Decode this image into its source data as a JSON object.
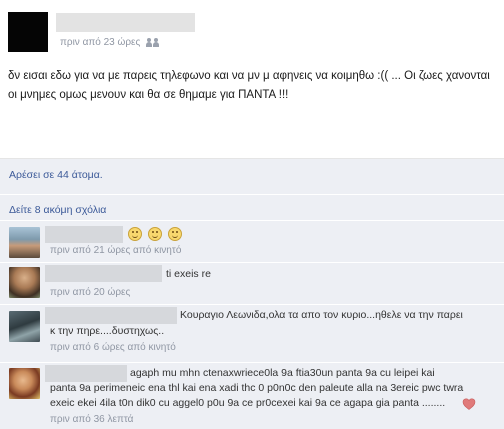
{
  "post": {
    "timestamp": "πριν από 23 ώρες",
    "audience_icon": "people-icon",
    "text": "δν εισαι εδω για να με παρεις τηλεφωνο και να μν μ αφηνεις να κοιμηθω :(( ... Οι ζωες χανονται οι μνημες ομως μενουν και θα σε θημαμε για ΠΑΝΤΑ !!!"
  },
  "likes": {
    "text": "Αρέσει σε 44 άτομα."
  },
  "more_comments": {
    "label": "Δείτε 8 ακόμη σχόλια"
  },
  "comments": [
    {
      "text": "",
      "icons": [
        "smiley-icon",
        "smiley-icon",
        "smiley-icon"
      ],
      "meta": "πριν από 21 ώρες από κινητό"
    },
    {
      "text": "ti exeis re",
      "meta": "πριν από 20 ώρες"
    },
    {
      "text_line1": "Κουραγιο Λεωνιδα,ολα τα απο τον κυριο...ηθελε να την παρει",
      "text_line2": "κ την πηρε....δυστηχως..",
      "meta": "πριν από 6 ώρες από κινητό"
    },
    {
      "text_line1": "agaph mu mhn ctenaxwriece0la 9a ftia30un panta 9a cu leipei kai",
      "text_line2": "panta 9a perimeneic ena thl kai ena xadi thc 0 p0n0c den paleute alla na 3ereic pwc twra",
      "text_line3": "exeic ekei 4ila t0n dik0 cu aggel0 p0u 9a ce pr0cexei kai 9a ce agapa gia panta ........",
      "heart_icon": "heart-icon",
      "meta": "πριν από 36 λεπτά"
    }
  ],
  "colors": {
    "link": "#3b5998",
    "meta": "#8f96a3",
    "feed_bg": "#edeff4",
    "heart": "#e07a7a"
  }
}
